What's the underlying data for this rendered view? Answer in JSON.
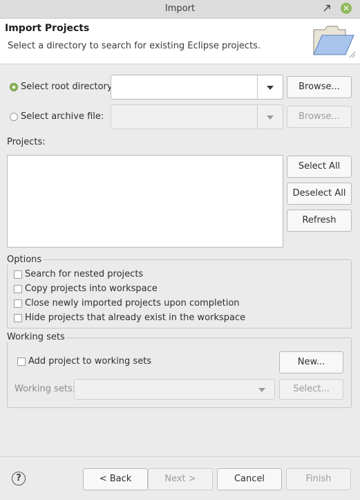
{
  "window": {
    "title": "Import"
  },
  "header": {
    "title": "Import Projects",
    "description": "Select a directory to search for existing Eclipse projects."
  },
  "source": {
    "root_dir_label": "Select root directory:",
    "root_dir_value": "",
    "root_browse_label": "Browse...",
    "archive_label": "Select archive file:",
    "archive_value": "",
    "archive_browse_label": "Browse...",
    "selected": "root_directory"
  },
  "projects": {
    "label": "Projects:",
    "items": [],
    "select_all_label": "Select All",
    "deselect_all_label": "Deselect All",
    "refresh_label": "Refresh"
  },
  "options": {
    "label": "Options",
    "items": [
      {
        "label": "Search for nested projects",
        "checked": false
      },
      {
        "label": "Copy projects into workspace",
        "checked": false
      },
      {
        "label": "Close newly imported projects upon completion",
        "checked": false
      },
      {
        "label": "Hide projects that already exist in the workspace",
        "checked": false
      }
    ]
  },
  "working_sets": {
    "label": "Working sets",
    "add_label": "Add project to working sets",
    "add_checked": false,
    "new_label": "New...",
    "sets_label": "Working sets:",
    "sets_value": "",
    "select_label": "Select..."
  },
  "footer": {
    "help_symbol": "?",
    "back_label": "< Back",
    "next_label": "Next >",
    "cancel_label": "Cancel",
    "finish_label": "Finish"
  },
  "colors": {
    "accent": "#8fb85a",
    "background": "#ebebeb",
    "header_bg": "#ffffff"
  }
}
